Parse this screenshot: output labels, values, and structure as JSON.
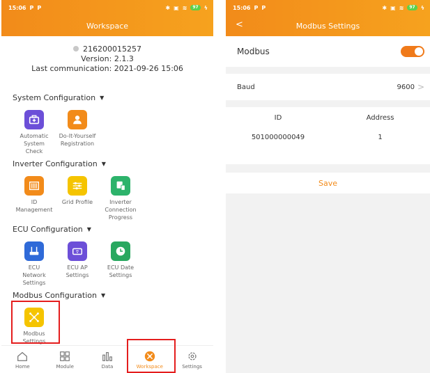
{
  "left": {
    "status": {
      "time": "15:06",
      "battery": "97"
    },
    "header": {
      "title": "Workspace"
    },
    "info": {
      "serial": "216200015257",
      "version": "Version: 2.1.3",
      "last_comm": "Last communication: 2021-09-26 15:06"
    },
    "sections": [
      {
        "title": "System Configuration",
        "items": [
          {
            "label": "Automatic System Check",
            "icon": "briefcase-medical-icon",
            "color": "#6c4fd8"
          },
          {
            "label": "Do-It-Yourself Registration",
            "icon": "user-icon",
            "color": "#f28b1a"
          }
        ]
      },
      {
        "title": "Inverter Configuration",
        "items": [
          {
            "label": "ID Management",
            "icon": "barcode-icon",
            "color": "#f28b1a"
          },
          {
            "label": "Grid Profile",
            "icon": "sliders-icon",
            "color": "#f5c400"
          },
          {
            "label": "Inverter Connection Progress",
            "icon": "connection-icon",
            "color": "#2db36b"
          }
        ]
      },
      {
        "title": "ECU Configuration",
        "items": [
          {
            "label": "ECU Network Settings",
            "icon": "network-icon",
            "color": "#2f6ad8"
          },
          {
            "label": "ECU AP Settings",
            "icon": "router-icon",
            "color": "#6c4fd8"
          },
          {
            "label": "ECU Date Settings",
            "icon": "clock-icon",
            "color": "#29a860"
          }
        ]
      },
      {
        "title": "Modbus Configuration",
        "items": [
          {
            "label": "Modbus Settings",
            "icon": "modbus-icon",
            "color": "#f5c400"
          }
        ]
      }
    ],
    "nav": [
      {
        "label": "Home",
        "icon": "home-icon"
      },
      {
        "label": "Module",
        "icon": "grid-icon"
      },
      {
        "label": "Data",
        "icon": "bar-chart-icon"
      },
      {
        "label": "Workspace",
        "icon": "workspace-icon"
      },
      {
        "label": "Settings",
        "icon": "gear-icon"
      }
    ]
  },
  "right": {
    "status": {
      "time": "15:06",
      "battery": "97"
    },
    "header": {
      "title": "Modbus Settings"
    },
    "modbus": {
      "label": "Modbus",
      "enabled": true
    },
    "baud": {
      "label": "Baud",
      "value": "9600"
    },
    "table": {
      "headers": [
        "ID",
        "Address"
      ],
      "rows": [
        [
          "501000000049",
          "1"
        ]
      ]
    },
    "save_label": "Save"
  },
  "colors": {
    "accent": "#f28b1a",
    "highlight": "#e41d1d",
    "toggle": "#f07a1a"
  }
}
